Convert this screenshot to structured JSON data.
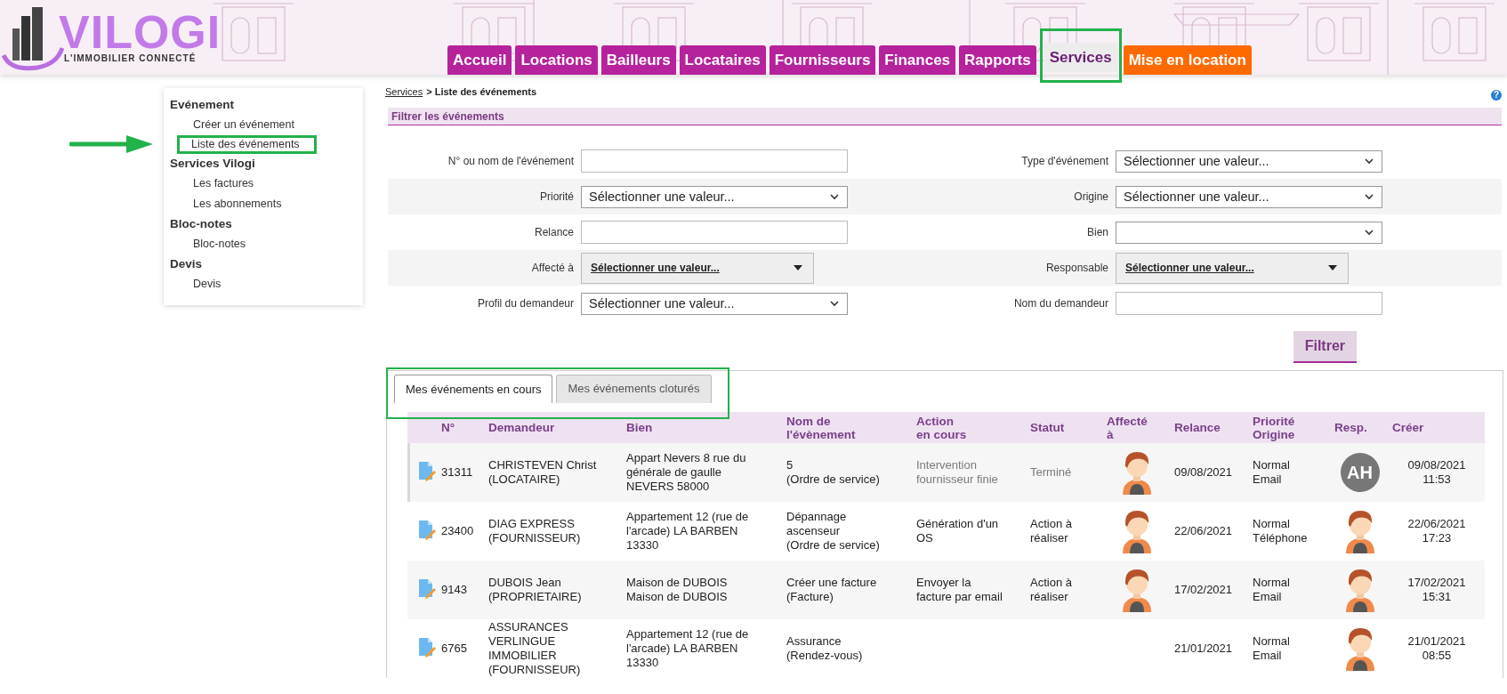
{
  "header": {
    "logo": {
      "name": "VILOGI",
      "tagline": "L'IMMOBILIER CONNECTÉ"
    },
    "nav": [
      {
        "label": "Accueil",
        "kind": "standard",
        "selected": false,
        "annotated": false
      },
      {
        "label": "Locations",
        "kind": "standard",
        "selected": false,
        "annotated": false
      },
      {
        "label": "Bailleurs",
        "kind": "standard",
        "selected": false,
        "annotated": false
      },
      {
        "label": "Locataires",
        "kind": "standard",
        "selected": false,
        "annotated": false
      },
      {
        "label": "Fournisseurs",
        "kind": "standard",
        "selected": false,
        "annotated": false
      },
      {
        "label": "Finances",
        "kind": "standard",
        "selected": false,
        "annotated": false
      },
      {
        "label": "Rapports",
        "kind": "standard",
        "selected": false,
        "annotated": false
      },
      {
        "label": "Services",
        "kind": "standard",
        "selected": true,
        "annotated": true
      },
      {
        "label": "Mise en location",
        "kind": "accent",
        "selected": false,
        "annotated": false
      }
    ]
  },
  "sidebar": {
    "sections": [
      {
        "title": "Evénement",
        "items": [
          {
            "label": "Créer un événement",
            "annotated": false
          },
          {
            "label": "Liste des événements",
            "annotated": true
          }
        ]
      },
      {
        "title": "Services Vilogi",
        "items": [
          {
            "label": "Les factures",
            "annotated": false
          },
          {
            "label": "Les abonnements",
            "annotated": false
          }
        ]
      },
      {
        "title": "Bloc-notes",
        "items": [
          {
            "label": "Bloc-notes",
            "annotated": false
          }
        ]
      },
      {
        "title": "Devis",
        "items": [
          {
            "label": "Devis",
            "annotated": false
          }
        ]
      }
    ]
  },
  "breadcrumb": {
    "link": "Services",
    "current": "> Liste des événements",
    "help": "?"
  },
  "filter": {
    "title": "Filtrer les événements",
    "fields": [
      {
        "label": "N° ou nom de l'événement",
        "kind": "text"
      },
      {
        "label": "Type d'événement",
        "kind": "select",
        "value": "Sélectionner une valeur..."
      },
      {
        "label": "Priorité",
        "kind": "select",
        "value": "Sélectionner une valeur..."
      },
      {
        "label": "Origine",
        "kind": "select",
        "value": "Sélectionner une valeur..."
      },
      {
        "label": "Relance",
        "kind": "text"
      },
      {
        "label": "Bien",
        "kind": "select"
      },
      {
        "label": "Affecté à",
        "kind": "dropdown",
        "value": "Sélectionner une valeur..."
      },
      {
        "label": "Responsable",
        "kind": "dropdown",
        "value": "Sélectionner une valeur..."
      },
      {
        "label": "Profil du demandeur",
        "kind": "select",
        "value": "Sélectionner une valeur..."
      },
      {
        "label": "Nom du demandeur",
        "kind": "text"
      }
    ],
    "button": "Filtrer"
  },
  "tabs": {
    "annotated": true,
    "items": [
      {
        "label": "Mes événements en cours",
        "selected": true
      },
      {
        "label": "Mes événements cloturés",
        "selected": false
      }
    ]
  },
  "table": {
    "columns": [
      "N°",
      "Demandeur",
      "Bien",
      "Nom de\nl'évènement",
      "Action\nen cours",
      "Statut",
      "Affecté\nà",
      "Relance",
      "Priorité\nOrigine",
      "Resp.",
      "Créer"
    ],
    "rows": [
      {
        "number": "31311",
        "requester": "CHRISTEVEN Christ\n(LOCATAIRE)",
        "property": "Appart Nevers 8 rue du\ngénérale de gaulle\nNEVERS 58000",
        "event_name": "5\n(Ordre de service)",
        "action": "Intervention\nfournisseur finie",
        "status": "Terminé",
        "finished": true,
        "assigned": {
          "kind": "avatar"
        },
        "reminder": "09/08/2021",
        "priority_origin": "Normal\nEmail",
        "responsible": {
          "kind": "initials",
          "text": "AH"
        },
        "created": "09/08/2021\n11:53"
      },
      {
        "number": "23400",
        "requester": "DIAG EXPRESS\n(FOURNISSEUR)",
        "property": "Appartement 12 (rue de\nl'arcade) LA BARBEN\n13330",
        "event_name": "Dépannage\nascenseur\n(Ordre de service)",
        "action": "Génération d'un\nOS",
        "status": "Action à\nréaliser",
        "finished": false,
        "assigned": {
          "kind": "avatar"
        },
        "reminder": "22/06/2021",
        "priority_origin": "Normal\nTéléphone",
        "responsible": {
          "kind": "avatar"
        },
        "created": "22/06/2021\n17:23"
      },
      {
        "number": "9143",
        "requester": "DUBOIS Jean\n(PROPRIETAIRE)",
        "property": "Maison de DUBOIS\nMaison de DUBOIS",
        "event_name": "Créer une facture\n(Facture)",
        "action": "Envoyer la\nfacture par email",
        "status": "Action à\nréaliser",
        "finished": false,
        "assigned": {
          "kind": "avatar"
        },
        "reminder": "17/02/2021",
        "priority_origin": "Normal\nEmail",
        "responsible": {
          "kind": "avatar"
        },
        "created": "17/02/2021\n15:31"
      },
      {
        "number": "6765",
        "requester": "ASSURANCES\nVERLINGUE\nIMMOBILIER\n(FOURNISSEUR)",
        "property": "Appartement 12 (rue de\nl'arcade) LA BARBEN\n13330",
        "event_name": "Assurance\n(Rendez-vous)",
        "finished": false,
        "reminder": "21/01/2021",
        "priority_origin": "Normal\nEmail",
        "responsible": {
          "kind": "avatar"
        },
        "created": "21/01/2021\n08:55"
      }
    ]
  }
}
